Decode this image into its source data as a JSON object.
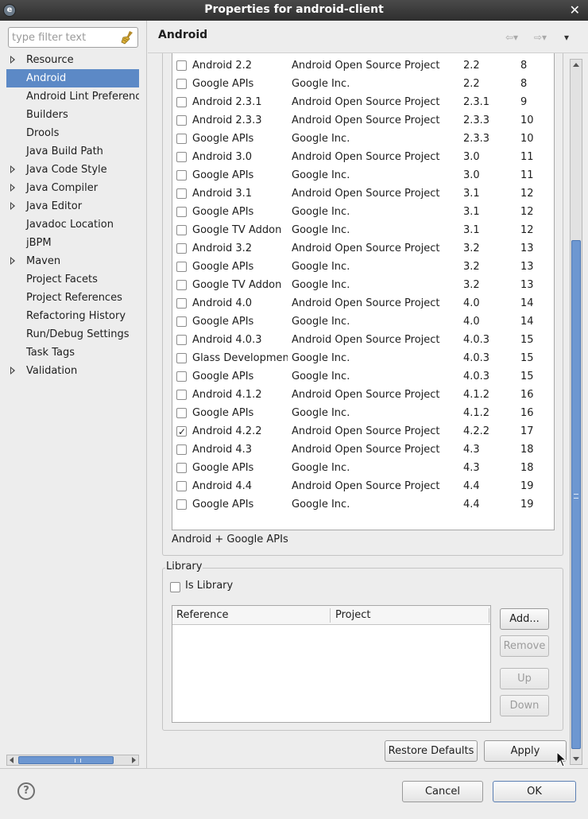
{
  "window": {
    "title": "Properties for android-client"
  },
  "filter": {
    "placeholder": "type filter text"
  },
  "tree": {
    "items": [
      {
        "label": "Resource",
        "expandable": true
      },
      {
        "label": "Android",
        "selected": true
      },
      {
        "label": "Android Lint Preferences"
      },
      {
        "label": "Builders"
      },
      {
        "label": "Drools"
      },
      {
        "label": "Java Build Path"
      },
      {
        "label": "Java Code Style",
        "expandable": true
      },
      {
        "label": "Java Compiler",
        "expandable": true
      },
      {
        "label": "Java Editor",
        "expandable": true
      },
      {
        "label": "Javadoc Location"
      },
      {
        "label": "jBPM"
      },
      {
        "label": "Maven",
        "expandable": true
      },
      {
        "label": "Project Facets"
      },
      {
        "label": "Project References"
      },
      {
        "label": "Refactoring History"
      },
      {
        "label": "Run/Debug Settings"
      },
      {
        "label": "Task Tags"
      },
      {
        "label": "Validation",
        "expandable": true
      }
    ]
  },
  "page": {
    "title": "Android"
  },
  "targets": {
    "rows": [
      {
        "name": "Android 2.2",
        "vendor": "Android Open Source Project",
        "platform": "2.2",
        "api": "8",
        "checked": false
      },
      {
        "name": "Google APIs",
        "vendor": "Google Inc.",
        "platform": "2.2",
        "api": "8",
        "checked": false
      },
      {
        "name": "Android 2.3.1",
        "vendor": "Android Open Source Project",
        "platform": "2.3.1",
        "api": "9",
        "checked": false
      },
      {
        "name": "Android 2.3.3",
        "vendor": "Android Open Source Project",
        "platform": "2.3.3",
        "api": "10",
        "checked": false
      },
      {
        "name": "Google APIs",
        "vendor": "Google Inc.",
        "platform": "2.3.3",
        "api": "10",
        "checked": false
      },
      {
        "name": "Android 3.0",
        "vendor": "Android Open Source Project",
        "platform": "3.0",
        "api": "11",
        "checked": false
      },
      {
        "name": "Google APIs",
        "vendor": "Google Inc.",
        "platform": "3.0",
        "api": "11",
        "checked": false
      },
      {
        "name": "Android 3.1",
        "vendor": "Android Open Source Project",
        "platform": "3.1",
        "api": "12",
        "checked": false
      },
      {
        "name": "Google APIs",
        "vendor": "Google Inc.",
        "platform": "3.1",
        "api": "12",
        "checked": false
      },
      {
        "name": "Google TV Addon",
        "vendor": "Google Inc.",
        "platform": "3.1",
        "api": "12",
        "checked": false
      },
      {
        "name": "Android 3.2",
        "vendor": "Android Open Source Project",
        "platform": "3.2",
        "api": "13",
        "checked": false
      },
      {
        "name": "Google APIs",
        "vendor": "Google Inc.",
        "platform": "3.2",
        "api": "13",
        "checked": false
      },
      {
        "name": "Google TV Addon",
        "vendor": "Google Inc.",
        "platform": "3.2",
        "api": "13",
        "checked": false
      },
      {
        "name": "Android 4.0",
        "vendor": "Android Open Source Project",
        "platform": "4.0",
        "api": "14",
        "checked": false
      },
      {
        "name": "Google APIs",
        "vendor": "Google Inc.",
        "platform": "4.0",
        "api": "14",
        "checked": false
      },
      {
        "name": "Android 4.0.3",
        "vendor": "Android Open Source Project",
        "platform": "4.0.3",
        "api": "15",
        "checked": false
      },
      {
        "name": "Glass Developmen",
        "vendor": "Google Inc.",
        "platform": "4.0.3",
        "api": "15",
        "checked": false
      },
      {
        "name": "Google APIs",
        "vendor": "Google Inc.",
        "platform": "4.0.3",
        "api": "15",
        "checked": false
      },
      {
        "name": "Android 4.1.2",
        "vendor": "Android Open Source Project",
        "platform": "4.1.2",
        "api": "16",
        "checked": false
      },
      {
        "name": "Google APIs",
        "vendor": "Google Inc.",
        "platform": "4.1.2",
        "api": "16",
        "checked": false
      },
      {
        "name": "Android 4.2.2",
        "vendor": "Android Open Source Project",
        "platform": "4.2.2",
        "api": "17",
        "checked": true
      },
      {
        "name": "Android 4.3",
        "vendor": "Android Open Source Project",
        "platform": "4.3",
        "api": "18",
        "checked": false
      },
      {
        "name": "Google APIs",
        "vendor": "Google Inc.",
        "platform": "4.3",
        "api": "18",
        "checked": false
      },
      {
        "name": "Android 4.4",
        "vendor": "Android Open Source Project",
        "platform": "4.4",
        "api": "19",
        "checked": false
      },
      {
        "name": "Google APIs",
        "vendor": "Google Inc.",
        "platform": "4.4",
        "api": "19",
        "checked": false
      }
    ],
    "selected_summary": "Android + Google APIs"
  },
  "library": {
    "group_label": "Library",
    "is_library_label": "Is Library",
    "is_library_checked": false,
    "columns": [
      "Reference",
      "Project"
    ],
    "buttons": {
      "add": "Add...",
      "remove": "Remove",
      "up": "Up",
      "down": "Down"
    }
  },
  "actions": {
    "restore_defaults": "Restore Defaults",
    "apply": "Apply"
  },
  "footer": {
    "cancel": "Cancel",
    "ok": "OK"
  },
  "colors": {
    "selection": "#5c89c6",
    "scroll_thumb": "#6d97d1"
  }
}
